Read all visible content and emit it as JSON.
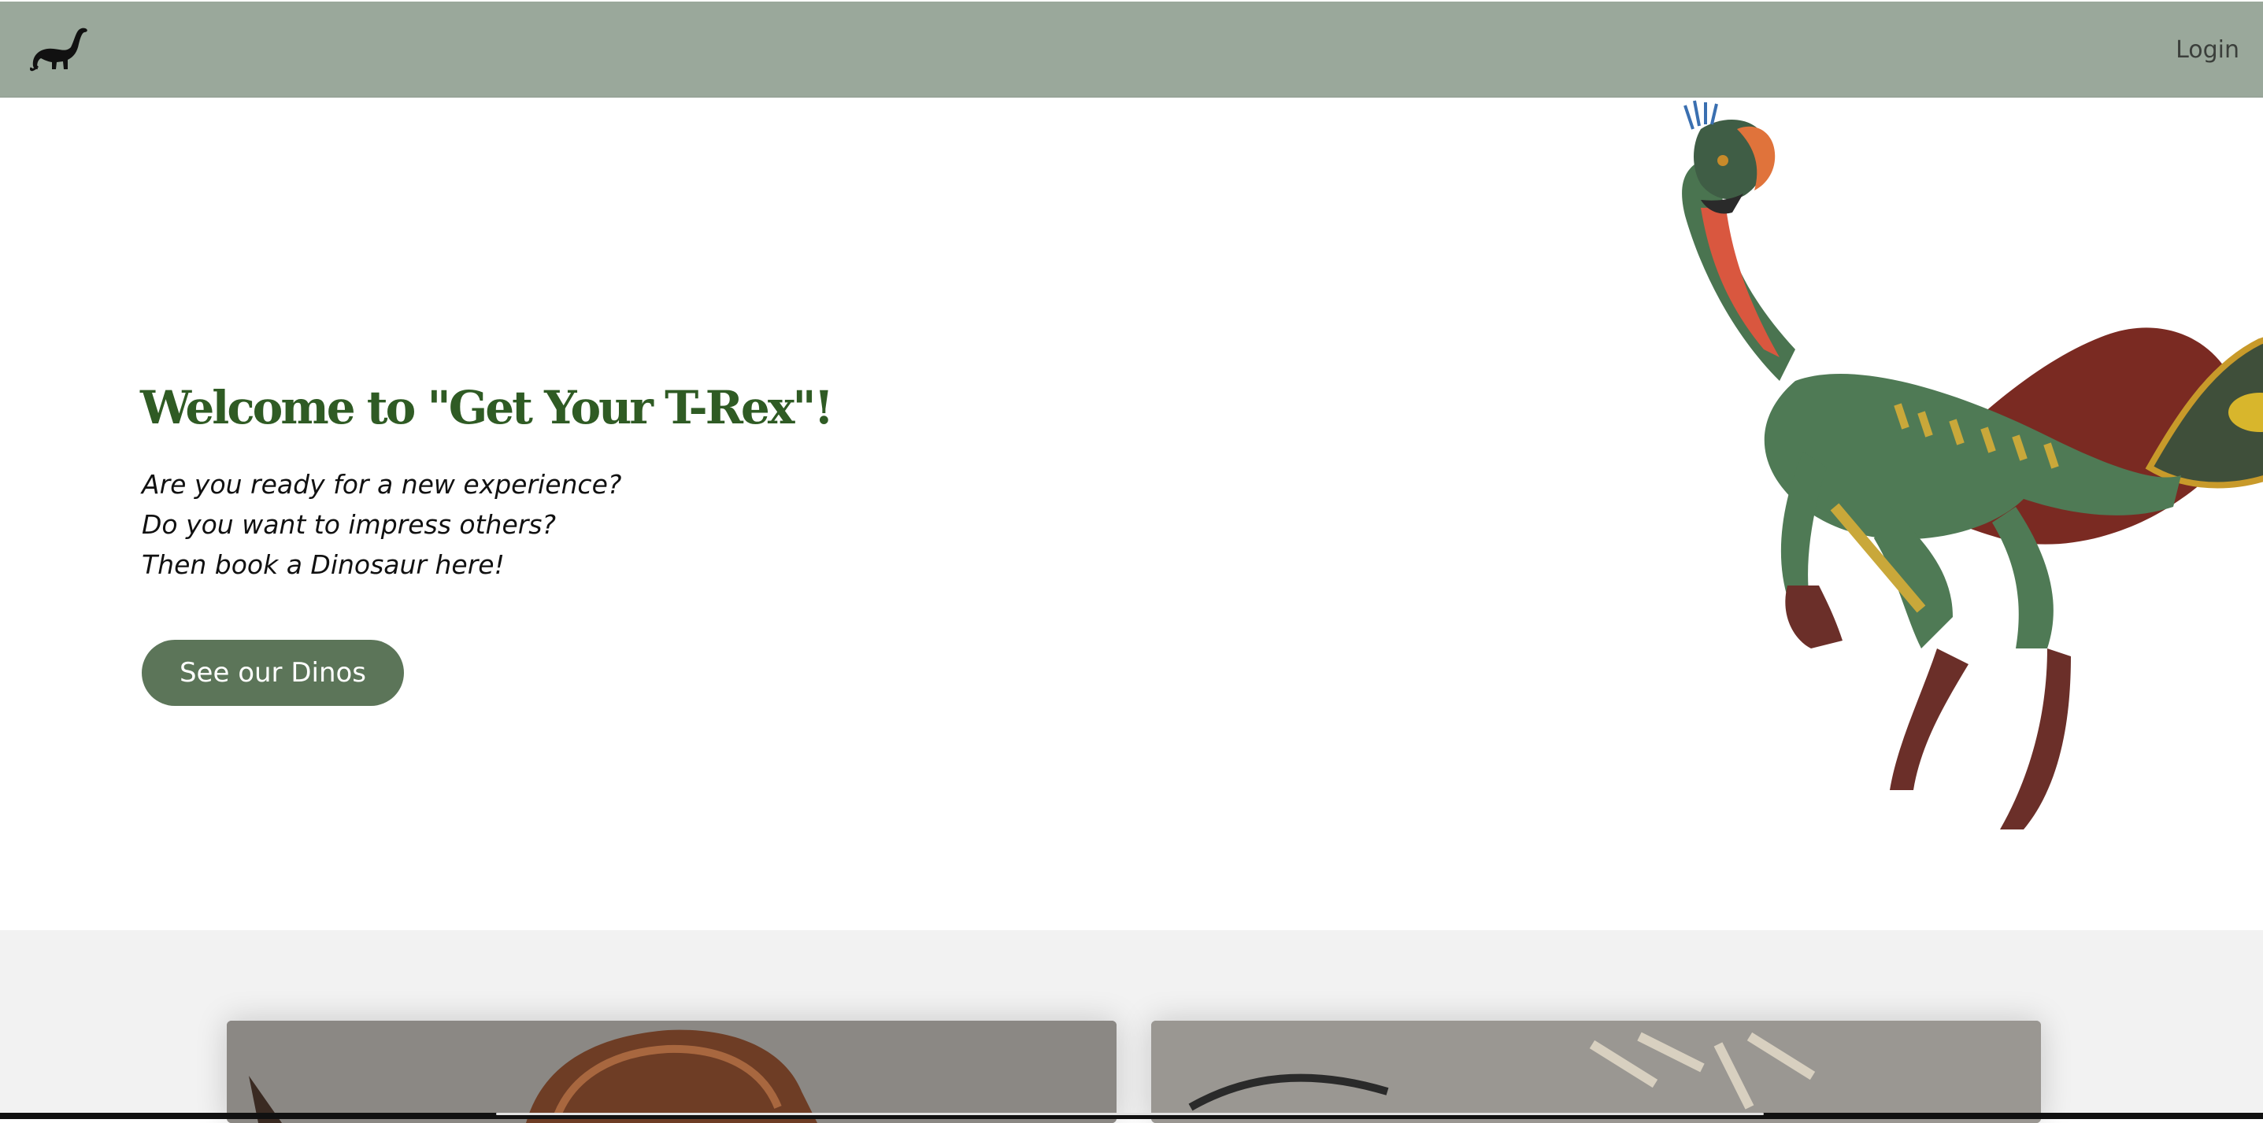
{
  "header": {
    "logo_icon": "dinosaur-logo-icon",
    "login_label": "Login",
    "background_color": "#9aa89b"
  },
  "hero": {
    "title": "Welcome to \"Get Your T-Rex\"!",
    "tagline": [
      "Are you ready for a new experience?",
      "Do you want to impress others?",
      "Then book a Dinosaur here!"
    ],
    "cta_label": "See our Dinos",
    "title_color": "#2f5b24",
    "cta_color": "#5c7559",
    "image": "feathered-dinosaur-illustration"
  },
  "gallery": {
    "cards": [
      {
        "image": "armored-dinosaur-photo"
      },
      {
        "image": "dinosaur-skeleton-photo"
      }
    ]
  }
}
